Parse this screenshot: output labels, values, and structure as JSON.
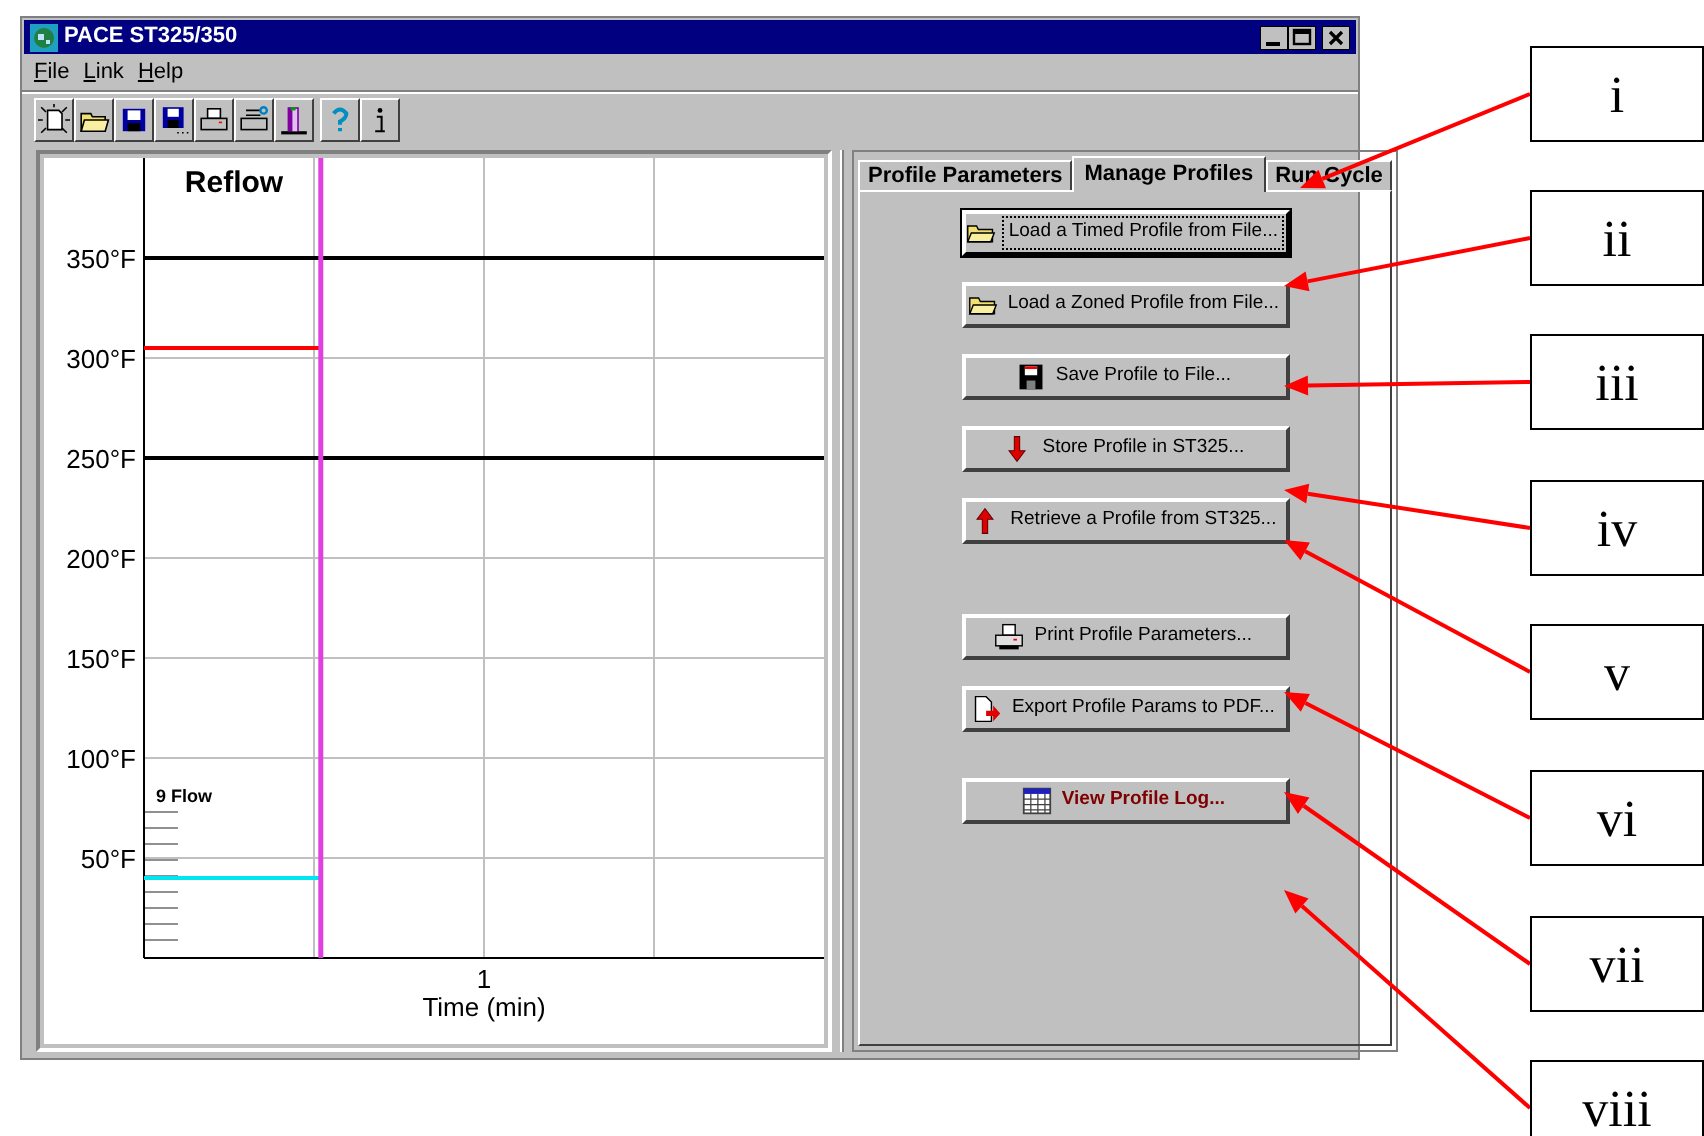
{
  "window": {
    "title": "PACE ST325/350"
  },
  "menu": [
    "File",
    "Link",
    "Help"
  ],
  "chart": {
    "title": "Reflow",
    "y_axis_labels": [
      "350°F",
      "300°F",
      "250°F",
      "200°F",
      "150°F",
      "100°F",
      "50°F"
    ],
    "x_axis_labels": [
      "1"
    ],
    "x_axis_title": "Time (min)",
    "flow_label": "9 Flow"
  },
  "tabs": [
    {
      "label": "Profile Parameters",
      "selected": false
    },
    {
      "label": "Manage Profiles",
      "selected": true
    },
    {
      "label": "Run Cycle",
      "selected": false
    }
  ],
  "button_groups": [
    [
      {
        "label": "Load a Timed Profile from File...",
        "kind": "folder",
        "focused": true,
        "emphasized": false
      },
      {
        "label": "Load a Zoned Profile from File...",
        "kind": "folder",
        "focused": false,
        "emphasized": false
      },
      {
        "label": "Save Profile to File...",
        "kind": "floppy",
        "focused": false,
        "emphasized": false
      },
      {
        "label": "Store Profile in ST325...",
        "kind": "arrow_down",
        "focused": false,
        "emphasized": false
      },
      {
        "label": "Retrieve a Profile from ST325...",
        "kind": "arrow_up",
        "focused": false,
        "emphasized": false
      }
    ],
    [
      {
        "label": "Print Profile Parameters...",
        "kind": "printer",
        "focused": false,
        "emphasized": false
      },
      {
        "label": "Export Profile Params to PDF...",
        "kind": "export",
        "focused": false,
        "emphasized": false
      }
    ],
    [
      {
        "label": "View Profile Log...",
        "kind": "table",
        "focused": false,
        "emphasized": true
      }
    ]
  ],
  "callouts": [
    "i",
    "ii",
    "iii",
    "iv",
    "v",
    "vi",
    "vii",
    "viii"
  ]
}
